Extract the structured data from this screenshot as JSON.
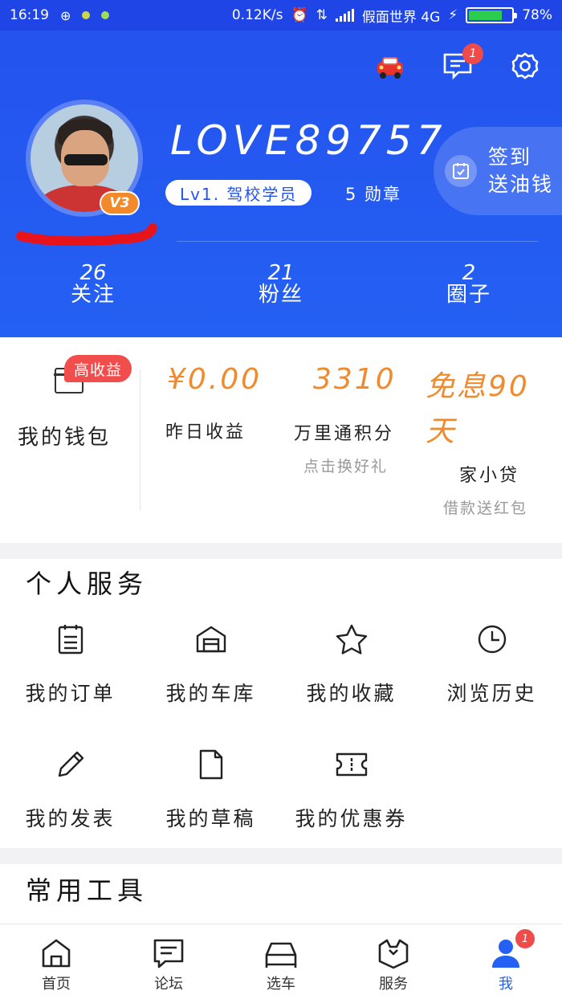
{
  "status_bar": {
    "time": "16:19",
    "network_speed": "0.12K/s",
    "carrier": "假面世界 4G",
    "battery_percent": "78%",
    "battery_level": 0.78
  },
  "header": {
    "username": "LOVE89757",
    "vip_badge": "V3",
    "level_label": "Lv1. 驾校学员",
    "badge_count_label": "5 勋章",
    "notification_count": "1",
    "signin_line1": "签到",
    "signin_line2": "送油钱",
    "stats": [
      {
        "num": "26",
        "label": "关注"
      },
      {
        "num": "21",
        "label": "粉丝"
      },
      {
        "num": "2",
        "label": "圈子"
      }
    ]
  },
  "wallet": {
    "tag": "高收益",
    "label": "我的钱包",
    "yesterday_value": "¥0.00",
    "yesterday_label": "昨日收益",
    "points_value": "3310",
    "points_label": "万里通积分",
    "points_sub": "点击换好礼",
    "loan_value_line1": "免息90",
    "loan_value_line2": "天",
    "loan_label": "家小贷",
    "loan_sub": "借款送红包",
    "accent_color": "#f08a2c"
  },
  "services": {
    "title": "个人服务",
    "items": [
      {
        "label": "我的订单",
        "icon": "order-icon"
      },
      {
        "label": "我的车库",
        "icon": "garage-icon"
      },
      {
        "label": "我的收藏",
        "icon": "star-icon"
      },
      {
        "label": "浏览历史",
        "icon": "clock-icon"
      },
      {
        "label": "我的发表",
        "icon": "pencil-icon"
      },
      {
        "label": "我的草稿",
        "icon": "document-icon"
      },
      {
        "label": "我的优惠券",
        "icon": "coupon-icon"
      }
    ]
  },
  "tools": {
    "title": "常用工具"
  },
  "bottom_nav": {
    "items": [
      {
        "label": "首页",
        "icon": "home-icon"
      },
      {
        "label": "论坛",
        "icon": "forum-icon"
      },
      {
        "label": "选车",
        "icon": "car-icon"
      },
      {
        "label": "服务",
        "icon": "service-icon"
      },
      {
        "label": "我",
        "icon": "profile-icon"
      }
    ],
    "profile_badge": "1",
    "active_color": "#2460f3"
  }
}
